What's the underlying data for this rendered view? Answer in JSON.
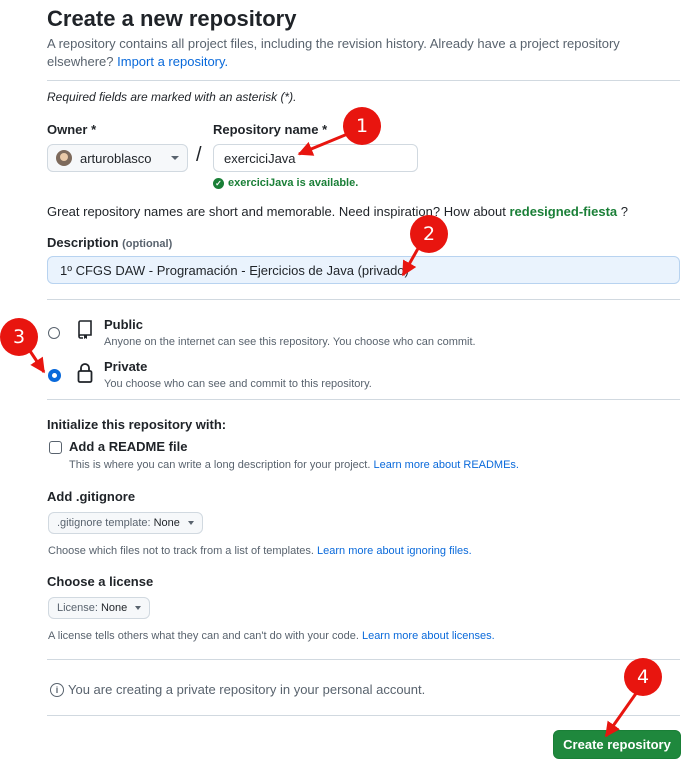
{
  "page": {
    "title": "Create a new repository",
    "subtitle": "A repository contains all project files, including the revision history. Already have a project repository elsewhere?",
    "import_link": "Import a repository.",
    "required_note": "Required fields are marked with an asterisk (*)."
  },
  "owner": {
    "label": "Owner *",
    "value": "arturoblasco",
    "avatar_icon": "user-avatar"
  },
  "repo": {
    "label": "Repository name *",
    "value": "exerciciJava",
    "available_text": "exerciciJava is available."
  },
  "inspiration": {
    "text": "Great repository names are short and memorable. Need inspiration? How about",
    "suggestion": "redesigned-fiesta",
    "suffix": "?"
  },
  "description": {
    "label": "Description",
    "optional": "(optional)",
    "value": "1º CFGS DAW - Programación - Ejercicios de Java (privado)"
  },
  "visibility": {
    "selected": "private",
    "options": [
      {
        "id": "public",
        "title": "Public",
        "desc": "Anyone on the internet can see this repository. You choose who can commit.",
        "icon": "repo-icon"
      },
      {
        "id": "private",
        "title": "Private",
        "desc": "You choose who can see and commit to this repository.",
        "icon": "lock-icon"
      }
    ]
  },
  "init": {
    "heading": "Initialize this repository with:",
    "readme": {
      "label": "Add a README file",
      "checked": false,
      "hint": "This is where you can write a long description for your project.",
      "link": "Learn more about READMEs."
    }
  },
  "gitignore": {
    "heading": "Add .gitignore",
    "select_label": ".gitignore template:",
    "select_value": "None",
    "hint": "Choose which files not to track from a list of templates.",
    "link": "Learn more about ignoring files."
  },
  "license": {
    "heading": "Choose a license",
    "select_label": "License:",
    "select_value": "None",
    "hint": "A license tells others what they can and can't do with your code.",
    "link": "Learn more about licenses."
  },
  "info_note": "You are creating a private repository in your personal account.",
  "create_button": "Create repository",
  "annotations": {
    "color": "#e8150f",
    "badges": [
      "1",
      "2",
      "3",
      "4"
    ]
  },
  "colors": {
    "primary": "#1f883d",
    "link": "#0969da",
    "success": "#1a7f37",
    "annotation": "#e8150f"
  }
}
